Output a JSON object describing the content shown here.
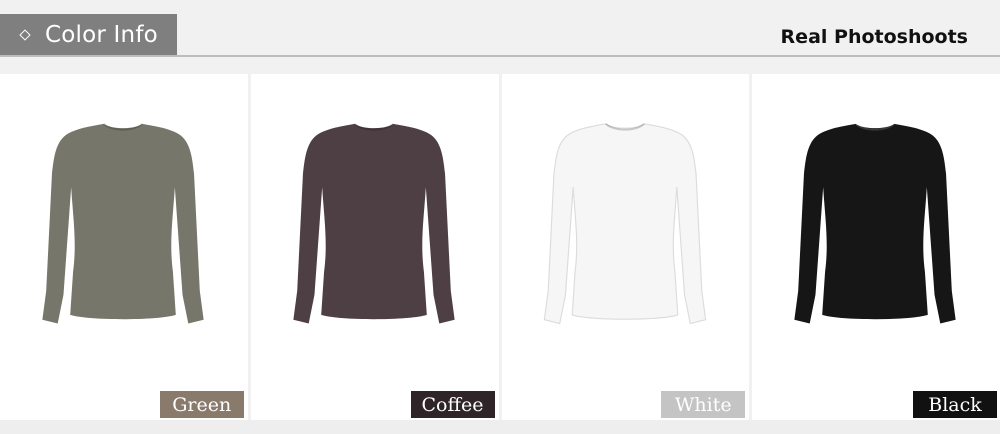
{
  "header": {
    "section_title": "Color Info",
    "subtitle": "Real Photoshoots",
    "tab_color": "#7f7f7f"
  },
  "colors": [
    {
      "name": "Green",
      "shirt_color": "#77766a",
      "tag_color": "#8a7a6c"
    },
    {
      "name": "Coffee",
      "shirt_color": "#4e3f45",
      "tag_color": "#2f2529"
    },
    {
      "name": "White",
      "shirt_color": "#f6f6f6",
      "tag_color": "#c4c4c4"
    },
    {
      "name": "Black",
      "shirt_color": "#161616",
      "tag_color": "#111111"
    }
  ]
}
